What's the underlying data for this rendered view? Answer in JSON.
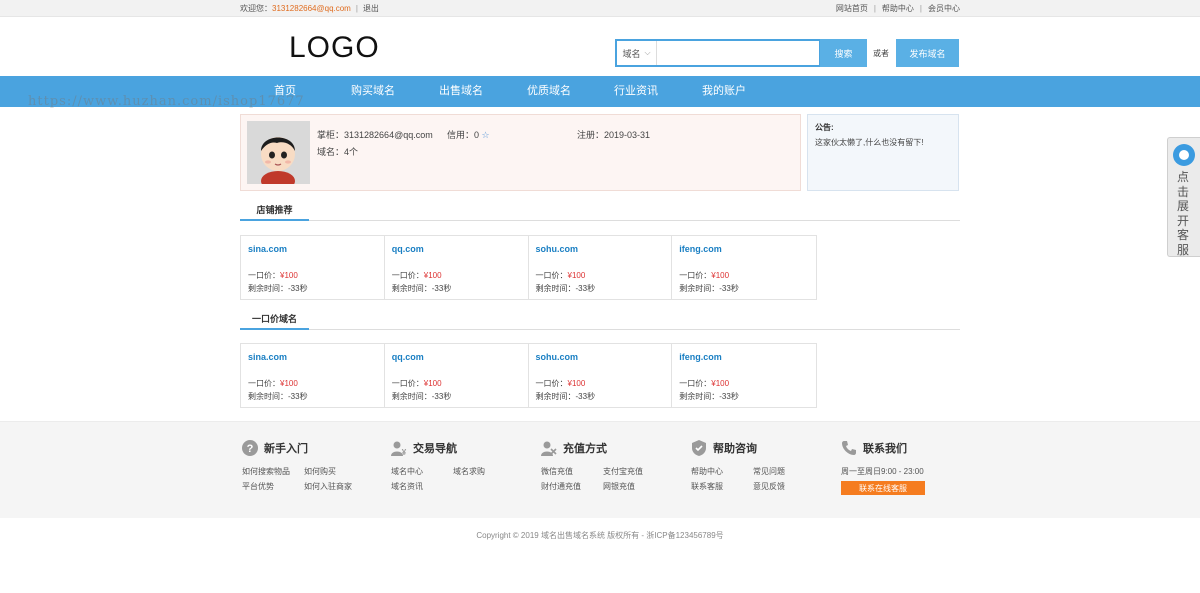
{
  "topbar": {
    "welcome": "欢迎您：",
    "email": "3131282664@qq.com",
    "logout": "退出",
    "right_links": [
      "网站首页",
      "帮助中心",
      "会员中心"
    ]
  },
  "header": {
    "logo": "LOGO",
    "search_select": "域名",
    "search_placeholder": "",
    "search_button": "搜索",
    "or_text": "或者",
    "publish_button": "发布域名"
  },
  "nav": {
    "items": [
      "首页",
      "购买域名",
      "出售域名",
      "优质域名",
      "行业资讯",
      "我的账户"
    ]
  },
  "watermark": "https://www.huzhan.com/ishop17677",
  "profile": {
    "owner_label": "掌柜：",
    "owner": "3131282664@qq.com",
    "credit_label": "信用：",
    "credit": "0",
    "register_label": "注册：",
    "register_date": "2019-03-31",
    "domains_label": "域名：",
    "domains_count": "4个"
  },
  "notice": {
    "title": "公告:",
    "content": "这家伙太懒了,什么也没有留下!"
  },
  "sections": [
    {
      "title": "店铺推荐",
      "cards": [
        {
          "name": "sina.com",
          "price_label": "一口价：",
          "price": "¥100",
          "time_label": "剩余时间：",
          "time": "-33秒"
        },
        {
          "name": "qq.com",
          "price_label": "一口价：",
          "price": "¥100",
          "time_label": "剩余时间：",
          "time": "-33秒"
        },
        {
          "name": "sohu.com",
          "price_label": "一口价：",
          "price": "¥100",
          "time_label": "剩余时间：",
          "time": "-33秒"
        },
        {
          "name": "ifeng.com",
          "price_label": "一口价：",
          "price": "¥100",
          "time_label": "剩余时间：",
          "time": "-33秒"
        }
      ]
    },
    {
      "title": "一口价域名",
      "cards": [
        {
          "name": "sina.com",
          "price_label": "一口价：",
          "price": "¥100",
          "time_label": "剩余时间：",
          "time": "-33秒"
        },
        {
          "name": "qq.com",
          "price_label": "一口价：",
          "price": "¥100",
          "time_label": "剩余时间：",
          "time": "-33秒"
        },
        {
          "name": "sohu.com",
          "price_label": "一口价：",
          "price": "¥100",
          "time_label": "剩余时间：",
          "time": "-33秒"
        },
        {
          "name": "ifeng.com",
          "price_label": "一口价：",
          "price": "¥100",
          "time_label": "剩余时间：",
          "time": "-33秒"
        }
      ]
    }
  ],
  "footer": {
    "columns": [
      {
        "icon": "question-icon",
        "title": "新手入门",
        "links": [
          "如何搜索物品",
          "如何购买",
          "平台优势",
          "如何入驻商家"
        ]
      },
      {
        "icon": "user-trade-icon",
        "title": "交易导航",
        "links": [
          "域名中心",
          "域名求购",
          "域名资讯"
        ]
      },
      {
        "icon": "recharge-icon",
        "title": "充值方式",
        "links": [
          "微信充值",
          "支付宝充值",
          "财付通充值",
          "网银充值"
        ]
      },
      {
        "icon": "shield-icon",
        "title": "帮助咨询",
        "links": [
          "帮助中心",
          "常见问题",
          "联系客服",
          "意见反馈"
        ]
      }
    ],
    "contact": {
      "icon": "phone-icon",
      "title": "联系我们",
      "hours": "周一至周日9:00 - 23:00",
      "button": "联系在线客服"
    }
  },
  "copyright": "Copyright © 2019 域名出售域名系统 版权所有 - 浙ICP备123456789号",
  "side_tab": {
    "icon": "qq-icon",
    "text": "点击展开客服"
  },
  "colors": {
    "accent": "#4aa3df",
    "button": "#5ab0e5",
    "orange": "#f57c1f",
    "link": "#1a7fc3",
    "price": "#dd3333"
  }
}
